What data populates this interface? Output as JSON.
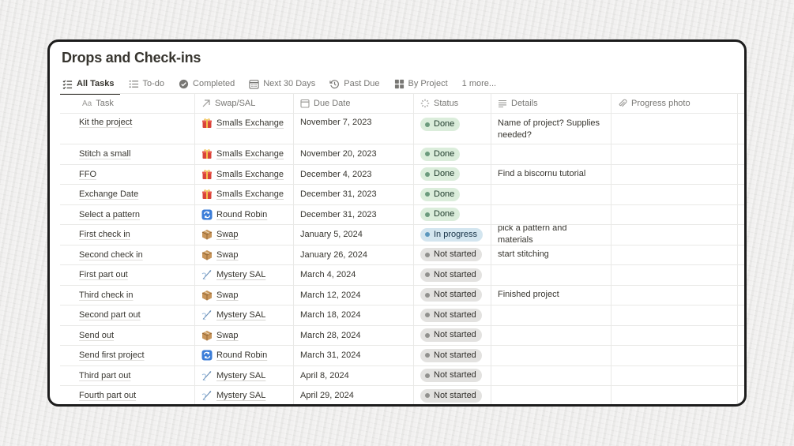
{
  "page": {
    "title": "Drops and Check-ins"
  },
  "tabs": [
    {
      "label": "All Tasks",
      "icon": "checklist-icon",
      "active": true
    },
    {
      "label": "To-do",
      "icon": "list-icon",
      "active": false
    },
    {
      "label": "Completed",
      "icon": "check-circle-icon",
      "active": false
    },
    {
      "label": "Next 30 Days",
      "icon": "calendar-icon",
      "active": false
    },
    {
      "label": "Past Due",
      "icon": "history-icon",
      "active": false
    },
    {
      "label": "By Project",
      "icon": "board-icon",
      "active": false
    }
  ],
  "more_tabs": "1 more...",
  "columns": [
    {
      "label": "Task",
      "icon": "text-aa-icon"
    },
    {
      "label": "Swap/SAL",
      "icon": "relation-arrow-icon"
    },
    {
      "label": "Due Date",
      "icon": "calendar-icon"
    },
    {
      "label": "Status",
      "icon": "status-icon"
    },
    {
      "label": "Details",
      "icon": "text-lines-icon"
    },
    {
      "label": "Progress photo",
      "icon": "paperclip-icon"
    }
  ],
  "rows": [
    {
      "task": "Kit the project",
      "project": "Smalls Exchange",
      "project_icon": "gift-icon",
      "due": "November 7, 2023",
      "status": "Done",
      "details": "Name of project? Supplies needed?"
    },
    {
      "task": "Stitch a small",
      "project": "Smalls Exchange",
      "project_icon": "gift-icon",
      "due": "November 20, 2023",
      "status": "Done",
      "details": ""
    },
    {
      "task": "FFO",
      "project": "Smalls Exchange",
      "project_icon": "gift-icon",
      "due": "December 4, 2023",
      "status": "Done",
      "details": "Find a biscornu tutorial"
    },
    {
      "task": "Exchange Date",
      "project": "Smalls Exchange",
      "project_icon": "gift-icon",
      "due": "December 31, 2023",
      "status": "Done",
      "details": ""
    },
    {
      "task": "Select a pattern",
      "project": "Round Robin",
      "project_icon": "repeat-icon",
      "due": "December 31, 2023",
      "status": "Done",
      "details": ""
    },
    {
      "task": "First check in",
      "project": "Swap",
      "project_icon": "package-icon",
      "due": "January 5, 2024",
      "status": "In progress",
      "details": "pick a pattern and materials"
    },
    {
      "task": "Second check in",
      "project": "Swap",
      "project_icon": "package-icon",
      "due": "January 26, 2024",
      "status": "Not started",
      "details": "start stitching"
    },
    {
      "task": "First part out",
      "project": "Mystery SAL",
      "project_icon": "needle-icon",
      "due": "March 4, 2024",
      "status": "Not started",
      "details": ""
    },
    {
      "task": "Third check in",
      "project": "Swap",
      "project_icon": "package-icon",
      "due": "March 12, 2024",
      "status": "Not started",
      "details": "Finished project"
    },
    {
      "task": "Second part out",
      "project": "Mystery SAL",
      "project_icon": "needle-icon",
      "due": "March 18, 2024",
      "status": "Not started",
      "details": ""
    },
    {
      "task": "Send out",
      "project": "Swap",
      "project_icon": "package-icon",
      "due": "March 28, 2024",
      "status": "Not started",
      "details": ""
    },
    {
      "task": "Send first project",
      "project": "Round Robin",
      "project_icon": "repeat-icon",
      "due": "March 31, 2024",
      "status": "Not started",
      "details": ""
    },
    {
      "task": "Third part out",
      "project": "Mystery SAL",
      "project_icon": "needle-icon",
      "due": "April 8, 2024",
      "status": "Not started",
      "details": ""
    },
    {
      "task": "Fourth part out",
      "project": "Mystery SAL",
      "project_icon": "needle-icon",
      "due": "April 29, 2024",
      "status": "Not started",
      "details": ""
    }
  ],
  "status_colors": {
    "Done": "#dbeddb",
    "In progress": "#d3e5ef",
    "Not started": "#e3e2e0"
  }
}
